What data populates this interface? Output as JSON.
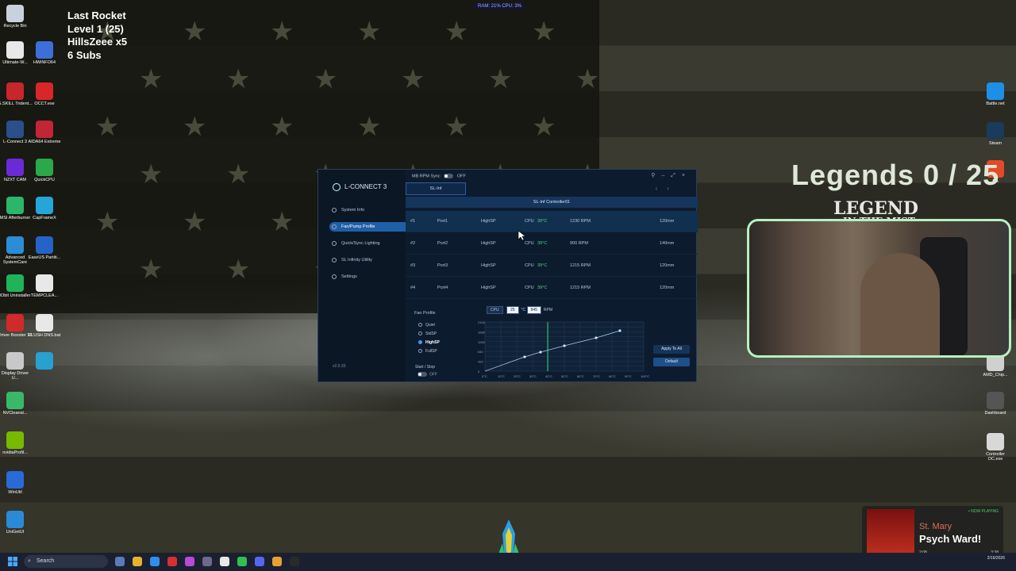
{
  "overlay": {
    "line1": "Last Rocket",
    "line2": "Level 1  (25)",
    "line3": "HillsZeee x5",
    "line4": "6 Subs",
    "top_stats": "RAM: 21%  CPU: 3%"
  },
  "desktop_left": [
    {
      "label": "Recycle Bin",
      "color": "#c9d2dc"
    },
    {
      "label": "Ultimate-W...",
      "color": "#e8e8e8"
    },
    {
      "label": "HWiNFO64",
      "color": "#3c6fd8"
    },
    {
      "label": "G.SKILL Trident...",
      "color": "#c8252c"
    },
    {
      "label": "OCCT.exe",
      "color": "#d9262b"
    },
    {
      "label": "L-Connect 3",
      "color": "#2a4f8a"
    },
    {
      "label": "AIDA64 Extreme",
      "color": "#c22535"
    },
    {
      "label": "NZXT CAM",
      "color": "#6a2bd6"
    },
    {
      "label": "QuickCPU",
      "color": "#2aa84a"
    },
    {
      "label": "MSI Afterburner",
      "color": "#2bb66a"
    },
    {
      "label": "CapFrameX",
      "color": "#26a6d8"
    },
    {
      "label": "Advanced SystemCare",
      "color": "#2b8cd8"
    },
    {
      "label": "EaseUS Partiti...",
      "color": "#2563c8"
    },
    {
      "label": "IObit Uninstaller",
      "color": "#20b35a"
    },
    {
      "label": "TEMPCLEA...",
      "color": "#e8e8e8"
    },
    {
      "label": "Driver Booster 13",
      "color": "#d02a2a"
    },
    {
      "label": "FLUSH DNS.bat",
      "color": "#e8e8e8"
    },
    {
      "label": "Display Driver U...",
      "color": "#c8c8c8"
    },
    {
      "label": "",
      "color": "#28a0d0"
    },
    {
      "label": "NVCleanst...",
      "color": "#3ab86a"
    },
    {
      "label": "nvidiaProfil...",
      "color": "#76b900"
    },
    {
      "label": "WinUtil",
      "color": "#2a6ad8"
    },
    {
      "label": "UniGetUI",
      "color": "#2a8ad8"
    }
  ],
  "desktop_right": [
    {
      "label": "Battle.net",
      "color": "#1e8fe8"
    },
    {
      "label": "Steam",
      "color": "#1b3a5c"
    },
    {
      "label": "EA",
      "color": "#e44a28"
    },
    {
      "label": "AMD_Chip...",
      "color": "#d0d0d0"
    },
    {
      "label": "Dashboard",
      "color": "#555"
    },
    {
      "label": "Controller OC.exe",
      "color": "#d8d8d8"
    }
  ],
  "app": {
    "brand": "L-CONNECT 3",
    "mb_sync_label": "MB RPM Sync",
    "mb_sync_state": "OFF",
    "nav": [
      "System Info",
      "Fan/Pump Profile",
      "Quick/Sync Lighting",
      "SL Infinity Utility",
      "Settings"
    ],
    "version": "v2.0.33",
    "tab": "SL-Inf",
    "controller": "SL-Inf Controller01",
    "rows": [
      {
        "id": "#1",
        "port": "Port1",
        "profile": "HighSP",
        "source": "CPU",
        "temp": "39°C",
        "rpm": "1230 RPM",
        "size": "120mm"
      },
      {
        "id": "#2",
        "port": "Port2",
        "profile": "HighSP",
        "source": "CPU",
        "temp": "39°C",
        "rpm": "900 RPM",
        "size": "140mm"
      },
      {
        "id": "#3",
        "port": "Port3",
        "profile": "HighSP",
        "source": "CPU",
        "temp": "39°C",
        "rpm": "1215 RPM",
        "size": "120mm"
      },
      {
        "id": "#4",
        "port": "Port4",
        "profile": "HighSP",
        "source": "CPU",
        "temp": "39°C",
        "rpm": "1215 RPM",
        "size": "120mm"
      }
    ],
    "fan_profile_title": "Fan Profile",
    "fan_profiles": [
      "Quiet",
      "StdSP",
      "HighSP",
      "FullSP"
    ],
    "selected_profile": "HighSP",
    "start_stop_label": "Start / Stop",
    "start_stop_state": "OFF",
    "chart_source": "CPU",
    "chart_temp_value": "25",
    "chart_temp_unit": "°C",
    "chart_rpm_value": "945",
    "chart_rpm_unit": "RPM",
    "apply_all": "Apply To All",
    "default": "Default",
    "y_ticks": [
      "2100",
      "1680",
      "1260",
      "840",
      "420",
      "0"
    ],
    "x_ticks": [
      "0°C",
      "10°C",
      "20°C",
      "30°C",
      "40°C",
      "50°C",
      "60°C",
      "70°C",
      "80°C",
      "90°C",
      "100°C"
    ]
  },
  "stream": {
    "legends_title": "Legends  0 / 25",
    "legend_logo": "LEGEND",
    "legend_sub": "IN THE MIST"
  },
  "now_playing": {
    "tag": "• NOW PLAYING",
    "artist": "St. Mary",
    "song": "Psych Ward!",
    "elapsed": "2:08",
    "total": "3:38"
  },
  "taskbar": {
    "search_placeholder": "Search",
    "time": "2/16/2026"
  }
}
